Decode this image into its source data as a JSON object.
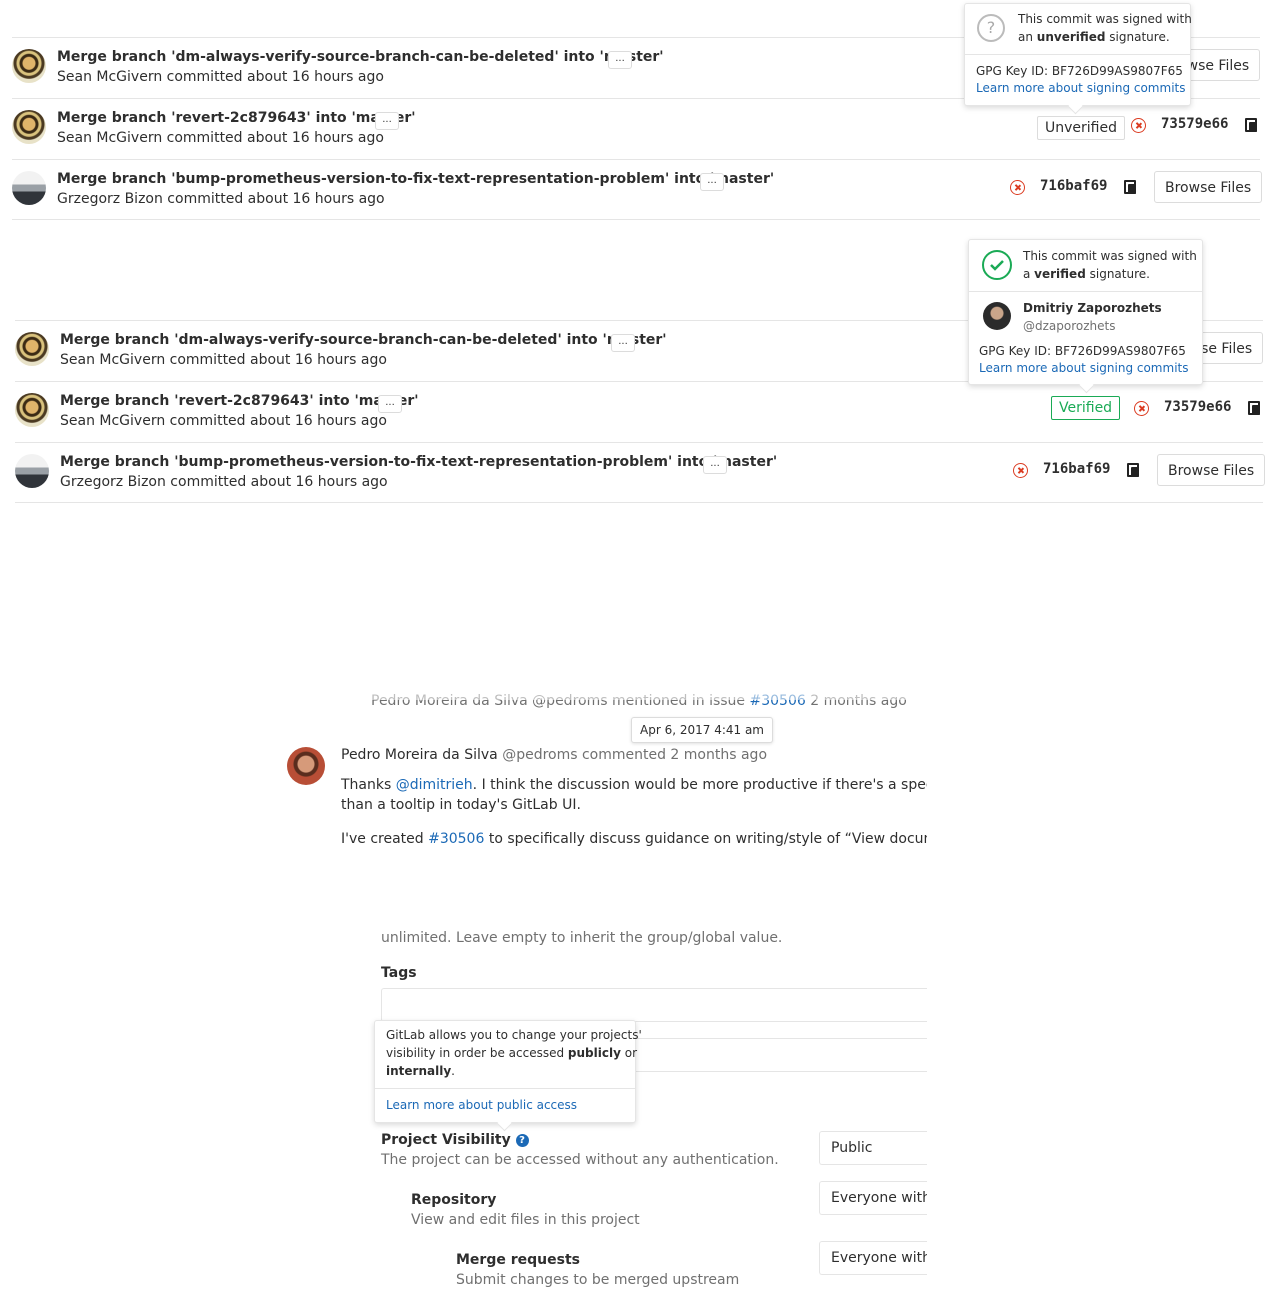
{
  "panel1": {
    "commits": [
      {
        "title": "Merge branch 'dm-always-verify-source-branch-can-be-deleted' into 'master'",
        "meta": "Sean McGivern committed about 16 hours ago",
        "ellipsis": "...",
        "browse": "Browse Files"
      },
      {
        "title": "Merge branch 'revert-2c879643' into 'master'",
        "meta": "Sean McGivern committed about 16 hours ago",
        "ellipsis": "...",
        "badge": "Unverified",
        "sha": "73579e66"
      },
      {
        "title": "Merge branch 'bump-prometheus-version-to-fix-text-representation-problem' into 'master'",
        "meta": "Grzegorz Bizon committed about 16 hours ago",
        "ellipsis": "...",
        "sha": "716baf69",
        "browse": "Browse Files"
      }
    ],
    "popover": {
      "line1": "This commit was signed with",
      "line2_prefix": "an ",
      "line2_bold": "unverified",
      "line2_suffix": " signature.",
      "gpg": "GPG Key ID: BF726D99AS9807F65",
      "link": "Learn more about signing commits"
    }
  },
  "panel2": {
    "commits": [
      {
        "title": "Merge branch 'dm-always-verify-source-branch-can-be-deleted' into 'master'",
        "meta": "Sean McGivern committed about 16 hours ago",
        "ellipsis": "...",
        "browse": "Browse Files"
      },
      {
        "title": "Merge branch 'revert-2c879643' into 'master'",
        "meta": "Sean McGivern committed about 16 hours ago",
        "ellipsis": "...",
        "badge": "Verified",
        "sha": "73579e66"
      },
      {
        "title": "Merge branch 'bump-prometheus-version-to-fix-text-representation-problem' into 'master'",
        "meta": "Grzegorz Bizon committed about 16 hours ago",
        "ellipsis": "...",
        "sha": "716baf69",
        "browse": "Browse Files"
      }
    ],
    "popover": {
      "line1": "This commit was signed with",
      "line2_prefix": "a ",
      "line2_bold": "verified",
      "line2_suffix": " signature.",
      "user_name": "Dmitriy Zaporozhets",
      "user_handle": "@dzaporozhets",
      "gpg": "GPG Key ID: BF726D99AS9807F65",
      "link": "Learn more about signing commits"
    }
  },
  "panel3": {
    "prev_line": {
      "prefix": "Pedro Moreira da Silva @pedroms mentioned in issue ",
      "link": "#30506",
      "suffix": " 2 months ago"
    },
    "tooltip": "Apr 6, 2017 4:41 am",
    "author": "Pedro Moreira da Silva",
    "handle": "@pedroms commented 2 months ago",
    "para1_prefix": "Thanks ",
    "para1_mention": "@dimitrieh",
    "para1_suffix": ". I think the discussion would be more productive if there's a specific e",
    "para1_line2": "than a tooltip in today's GitLab UI.",
    "para2_prefix": "I've created ",
    "para2_link": "#30506",
    "para2_suffix": " to specifically discuss guidance on writing/style of “View documenta"
  },
  "panel4": {
    "top_text": "unlimited. Leave empty to inherit the group/global value.",
    "tags_label": "Tags",
    "popover": {
      "line1": "GitLab allows you to change your projects'",
      "line2_prefix": "visibility in order be accessed ",
      "line2_bold": "publicly",
      "line2_suffix": " or",
      "line3_bold": "internally",
      "line3_suffix": ".",
      "link": "Learn more about public access"
    },
    "visibility_label": "Project Visibility",
    "visibility_desc": "The project can be accessed without any authentication.",
    "visibility_value": "Public",
    "repo_label": "Repository",
    "repo_desc": "View and edit files in this project",
    "repo_value": "Everyone with",
    "mr_label": "Merge requests",
    "mr_desc": "Submit changes to be merged upstream",
    "mr_value": "Everyone with"
  },
  "colors": {
    "link": "#1b69b6",
    "danger": "#db3b21",
    "verified": "#1aaa55"
  }
}
